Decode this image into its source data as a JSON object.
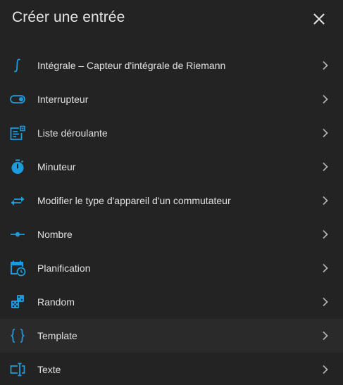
{
  "dialog": {
    "title": "Créer une entrée",
    "close_icon": "close-icon"
  },
  "accent_color": "#1e9bdc",
  "items": [
    {
      "label": "Intégrale – Capteur d'intégrale de Riemann",
      "icon": "integral-icon"
    },
    {
      "label": "Interrupteur",
      "icon": "toggle-switch-icon"
    },
    {
      "label": "Liste déroulante",
      "icon": "form-dropdown-icon"
    },
    {
      "label": "Minuteur",
      "icon": "timer-icon"
    },
    {
      "label": "Modifier le type d'appareil d'un commutateur",
      "icon": "swap-horizontal-icon"
    },
    {
      "label": "Nombre",
      "icon": "ray-vertex-icon"
    },
    {
      "label": "Planification",
      "icon": "calendar-clock-icon"
    },
    {
      "label": "Random",
      "icon": "dice-icon"
    },
    {
      "label": "Template",
      "icon": "code-braces-icon"
    },
    {
      "label": "Texte",
      "icon": "form-textbox-icon"
    }
  ]
}
